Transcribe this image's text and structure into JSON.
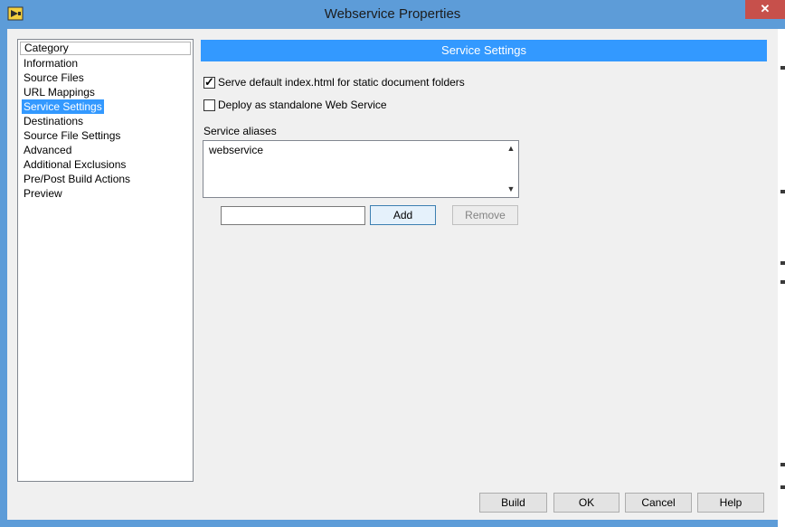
{
  "window": {
    "title": "Webservice Properties",
    "close_label": "✕",
    "colors": {
      "titlebar": "#5d9cd8",
      "close": "#c7504b",
      "accent": "#3399ff"
    }
  },
  "sidebar": {
    "header": "Category",
    "items": [
      {
        "label": "Information",
        "selected": false
      },
      {
        "label": "Source Files",
        "selected": false
      },
      {
        "label": "URL Mappings",
        "selected": false
      },
      {
        "label": "Service Settings",
        "selected": true
      },
      {
        "label": "Destinations",
        "selected": false
      },
      {
        "label": "Source File Settings",
        "selected": false
      },
      {
        "label": "Advanced",
        "selected": false
      },
      {
        "label": "Additional Exclusions",
        "selected": false
      },
      {
        "label": "Pre/Post Build Actions",
        "selected": false
      },
      {
        "label": "Preview",
        "selected": false
      }
    ]
  },
  "main": {
    "section_title": "Service Settings",
    "serve_default": {
      "label": "Serve default index.html for static document folders",
      "checked": true
    },
    "deploy_standalone": {
      "label": "Deploy as standalone Web Service",
      "checked": false
    },
    "aliases": {
      "label": "Service aliases",
      "items": [
        "webservice"
      ],
      "new_alias_value": "",
      "add_label": "Add",
      "remove_label": "Remove"
    }
  },
  "footer": {
    "build_label": "Build",
    "ok_label": "OK",
    "cancel_label": "Cancel",
    "help_label": "Help"
  }
}
